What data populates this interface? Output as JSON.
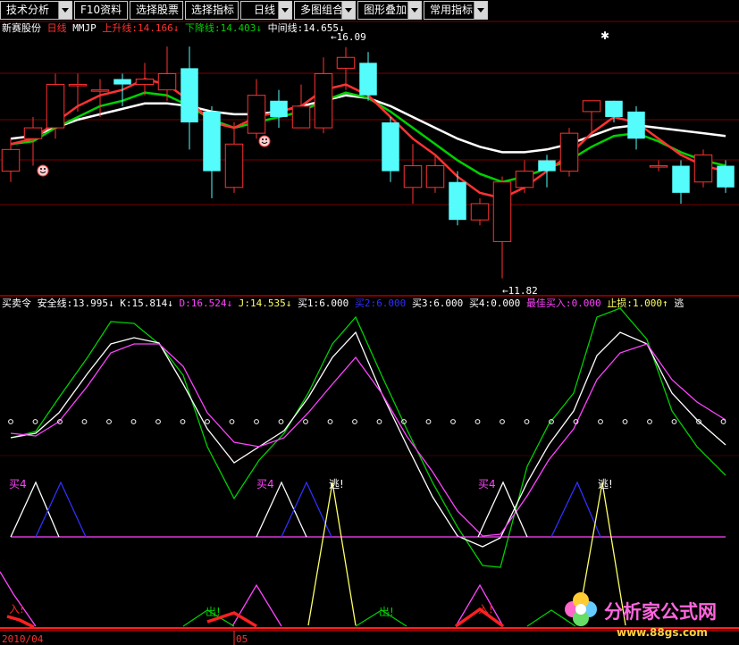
{
  "toolbar": {
    "buttons": [
      {
        "label": "技术分析"
      },
      {
        "label": "F10资料"
      },
      {
        "label": "选择股票"
      },
      {
        "label": "选择指标"
      },
      {
        "label": "日线"
      },
      {
        "label": "多图组合"
      },
      {
        "label": "图形叠加"
      },
      {
        "label": "常用指标"
      }
    ]
  },
  "colors": {
    "up": "#ff3232",
    "down": "#54fcfc",
    "grid": "#7a0000",
    "green": "#00d000",
    "white": "#ffffff",
    "magenta": "#ff44ff",
    "blue": "#2f2fff",
    "yellow": "#ffff66",
    "red": "#ff2020"
  },
  "main_panel": {
    "stock_name": "新赛股份",
    "period": "日线",
    "indicator": "MMJP",
    "fields": [
      {
        "label": "上升线:",
        "value": "14.166↓",
        "color": "#ff3232"
      },
      {
        "label": "下降线:",
        "value": "14.403↓",
        "color": "#00d000"
      },
      {
        "label": "中间线:",
        "value": "14.655↓",
        "color": "#ffffff"
      }
    ],
    "high_mark": "←16.09",
    "low_mark": "←11.82"
  },
  "sub_panel": {
    "name": "买卖令",
    "fields": [
      {
        "label": "安全线:",
        "value": "13.995↓",
        "color": "#ffffff"
      },
      {
        "label": "K:",
        "value": "15.814↓",
        "color": "#ffffff"
      },
      {
        "label": "D:",
        "value": "16.524↓",
        "color": "#ff44ff"
      },
      {
        "label": "J:",
        "value": "14.535↓",
        "color": "#ffff66"
      },
      {
        "label": "买1:",
        "value": "6.000",
        "color": "#ffffff"
      },
      {
        "label": "买2:",
        "value": "6.000",
        "color": "#2f2fff"
      },
      {
        "label": "买3:",
        "value": "6.000",
        "color": "#ffffff"
      },
      {
        "label": "买4:",
        "value": "0.000",
        "color": "#ffffff"
      },
      {
        "label": "最佳买入:",
        "value": "0.000",
        "color": "#ff44ff"
      },
      {
        "label": "止损:",
        "value": "1.000↑",
        "color": "#ffff66"
      },
      {
        "label": "逃",
        "value": "",
        "color": "#ffffff"
      }
    ],
    "signal_labels": {
      "buy4": "买4",
      "escape": "逃!",
      "out": "出!",
      "in": "入!"
    }
  },
  "x_axis": {
    "labels": [
      "2010/04",
      "05"
    ]
  },
  "watermark": {
    "brand": "分析家公式网",
    "url": "www.88gs.com"
  },
  "chart_data": {
    "type": "candlestick",
    "candles": [
      {
        "o": 13.8,
        "c": 14.2,
        "h": 14.4,
        "l": 13.6
      },
      {
        "o": 14.4,
        "c": 14.6,
        "h": 14.8,
        "l": 13.9
      },
      {
        "o": 14.6,
        "c": 15.4,
        "h": 15.6,
        "l": 14.4
      },
      {
        "o": 15.4,
        "c": 15.4,
        "h": 15.6,
        "l": 14.9
      },
      {
        "o": 15.3,
        "c": 15.3,
        "h": 15.5,
        "l": 14.8
      },
      {
        "o": 15.5,
        "c": 15.4,
        "h": 15.6,
        "l": 15.0
      },
      {
        "o": 15.4,
        "c": 15.5,
        "h": 15.8,
        "l": 15.2
      },
      {
        "o": 15.3,
        "c": 15.6,
        "h": 16.1,
        "l": 15.1
      },
      {
        "o": 15.7,
        "c": 14.7,
        "h": 16.1,
        "l": 14.2
      },
      {
        "o": 14.9,
        "c": 13.8,
        "h": 15.0,
        "l": 13.3
      },
      {
        "o": 13.5,
        "c": 14.3,
        "h": 14.7,
        "l": 13.4
      },
      {
        "o": 14.5,
        "c": 15.2,
        "h": 15.5,
        "l": 14.4
      },
      {
        "o": 15.1,
        "c": 14.8,
        "h": 15.3,
        "l": 14.6
      },
      {
        "o": 14.6,
        "c": 15.0,
        "h": 15.4,
        "l": 14.6
      },
      {
        "o": 14.6,
        "c": 15.6,
        "h": 15.9,
        "l": 14.5
      },
      {
        "o": 15.7,
        "c": 15.9,
        "h": 16.09,
        "l": 15.3
      },
      {
        "o": 15.8,
        "c": 15.2,
        "h": 16.0,
        "l": 15.1
      },
      {
        "o": 14.7,
        "c": 13.8,
        "h": 14.8,
        "l": 13.6
      },
      {
        "o": 13.5,
        "c": 13.9,
        "h": 14.3,
        "l": 13.2
      },
      {
        "o": 13.5,
        "c": 13.9,
        "h": 14.1,
        "l": 13.4
      },
      {
        "o": 13.6,
        "c": 12.9,
        "h": 13.8,
        "l": 12.8
      },
      {
        "o": 12.9,
        "c": 13.2,
        "h": 13.3,
        "l": 12.8
      },
      {
        "o": 12.5,
        "c": 13.6,
        "h": 13.7,
        "l": 11.82
      },
      {
        "o": 13.5,
        "c": 13.8,
        "h": 14.0,
        "l": 13.4
      },
      {
        "o": 14.0,
        "c": 13.8,
        "h": 14.1,
        "l": 13.5
      },
      {
        "o": 13.8,
        "c": 14.5,
        "h": 14.6,
        "l": 13.7
      },
      {
        "o": 14.9,
        "c": 15.1,
        "h": 15.1,
        "l": 14.5
      },
      {
        "o": 15.1,
        "c": 14.8,
        "h": 15.1,
        "l": 14.7
      },
      {
        "o": 14.9,
        "c": 14.4,
        "h": 15.0,
        "l": 14.2
      },
      {
        "o": 13.9,
        "c": 13.9,
        "h": 14.0,
        "l": 13.8
      },
      {
        "o": 13.9,
        "c": 13.4,
        "h": 14.0,
        "l": 13.2
      },
      {
        "o": 13.6,
        "c": 14.1,
        "h": 14.2,
        "l": 13.5
      },
      {
        "o": 13.9,
        "c": 13.5,
        "h": 14.0,
        "l": 13.4
      }
    ],
    "series": [
      {
        "name": "上升线",
        "values": [
          14.3,
          14.4,
          14.7,
          15.0,
          15.2,
          15.3,
          15.5,
          15.4,
          15.1,
          14.7,
          14.6,
          14.8,
          14.9,
          15.0,
          15.3,
          15.4,
          15.2,
          14.8,
          14.4,
          14.1,
          13.7,
          13.4,
          13.3,
          13.5,
          13.8,
          14.1,
          14.5,
          14.8,
          14.7,
          14.4,
          14.1,
          13.9,
          13.8
        ]
      },
      {
        "name": "下降线",
        "values": [
          14.3,
          14.35,
          14.6,
          14.8,
          15.0,
          15.1,
          15.25,
          15.2,
          15.0,
          14.75,
          14.6,
          14.7,
          14.8,
          14.9,
          15.1,
          15.25,
          15.15,
          14.9,
          14.6,
          14.3,
          14.0,
          13.75,
          13.6,
          13.7,
          13.85,
          14.0,
          14.25,
          14.45,
          14.5,
          14.35,
          14.15,
          14.0,
          13.9
        ]
      },
      {
        "name": "中间线",
        "values": [
          14.4,
          14.45,
          14.6,
          14.75,
          14.85,
          14.95,
          15.05,
          15.05,
          15.0,
          14.9,
          14.85,
          14.85,
          14.9,
          15.0,
          15.1,
          15.2,
          15.15,
          15.0,
          14.8,
          14.6,
          14.4,
          14.25,
          14.15,
          14.15,
          14.2,
          14.3,
          14.45,
          14.6,
          14.65,
          14.6,
          14.55,
          14.5,
          14.45
        ]
      }
    ],
    "ylim": [
      11.6,
      16.3
    ]
  }
}
